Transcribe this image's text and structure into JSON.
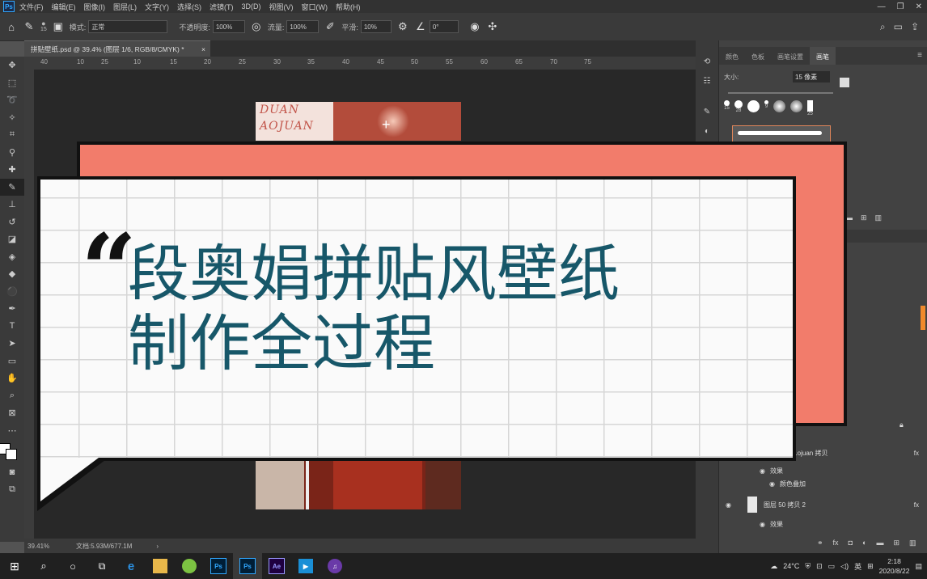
{
  "menubar": {
    "items": [
      "文件(F)",
      "编辑(E)",
      "图像(I)",
      "图层(L)",
      "文字(Y)",
      "选择(S)",
      "滤镜(T)",
      "3D(D)",
      "视图(V)",
      "窗口(W)",
      "帮助(H)"
    ]
  },
  "options": {
    "brush_size": "15",
    "mode_label": "模式:",
    "mode_value": "正常",
    "opacity_label": "不透明度:",
    "opacity_value": "100%",
    "flow_label": "流量:",
    "flow_value": "100%",
    "smooth_label": "平滑:",
    "smooth_value": "10%",
    "angle_value": "0°"
  },
  "document": {
    "tab_title": "拼贴壁纸.psd @ 39.4% (图层 1/6, RGB/8/CMYK) *",
    "ruler_ticks": [
      "40",
      "10",
      "25",
      "10",
      "15",
      "20",
      "25",
      "30",
      "35",
      "40",
      "45",
      "50",
      "55",
      "60",
      "65",
      "70",
      "75"
    ],
    "zoom": "39.41%",
    "doc_size": "文档:5.93M/677.1M"
  },
  "photo": {
    "label_line1": "DUAN",
    "label_line2": "AOJUAN"
  },
  "panels": {
    "tabs": [
      "颜色",
      "色板",
      "画笔设置",
      "画笔"
    ],
    "brush_size_label": "大小:",
    "brush_size_value": "15 像素",
    "presets": [
      "15",
      "28",
      "",
      "9",
      "",
      "",
      "25"
    ]
  },
  "layers": [
    {
      "name": "...ojuan 拷贝",
      "fx": "fx"
    },
    {
      "name": "效果",
      "fx": ""
    },
    {
      "name": "颜色叠加",
      "fx": ""
    },
    {
      "name": "图层 50 拷贝 2",
      "fx": "fx"
    },
    {
      "name": "效果",
      "fx": ""
    }
  ],
  "overlay": {
    "quote": "“",
    "line1": "段奥娟拼贴风壁纸",
    "line2": "制作全过程"
  },
  "taskbar": {
    "weather": "24°C",
    "ime": "英",
    "time": "2:18",
    "date": "2020/8/22"
  },
  "colors": {
    "accent_salmon": "#f27c6b",
    "headline_teal": "#175769",
    "ps_blue": "#31a8ff"
  }
}
